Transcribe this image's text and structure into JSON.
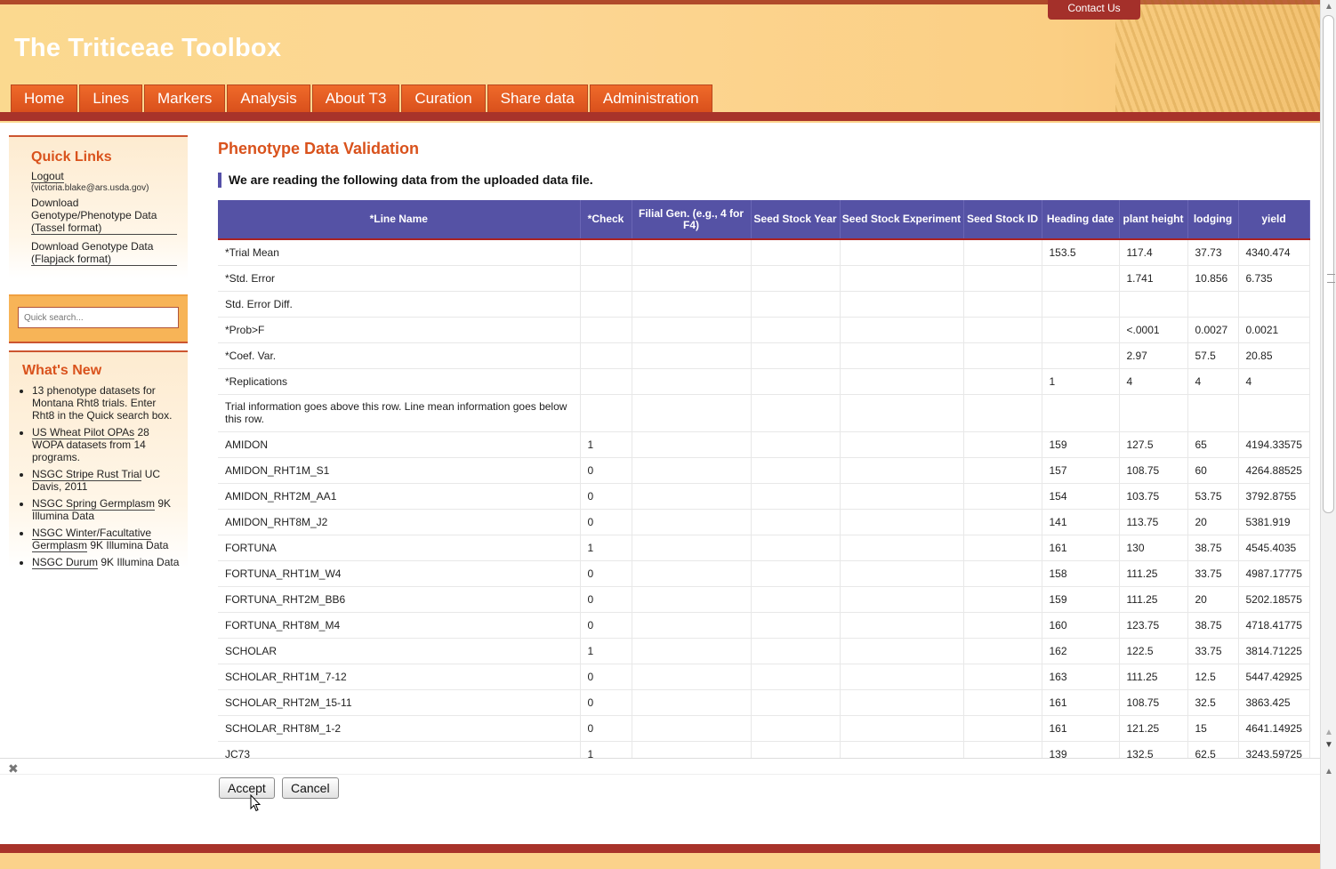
{
  "header": {
    "title": "The Triticeae Toolbox",
    "contact": "Contact Us",
    "nav": [
      "Home",
      "Lines",
      "Markers",
      "Analysis",
      "About T3",
      "Curation",
      "Share data",
      "Administration"
    ]
  },
  "sidebar": {
    "quick_links_title": "Quick Links",
    "logout": "Logout",
    "user_email": "(victoria.blake@ars.usda.gov)",
    "link_tassel": "Download Genotype/Phenotype Data (Tassel format)",
    "link_flapjack": "Download Genotype Data (Flapjack format)",
    "search_placeholder": "Quick search...",
    "whats_new_title": "What's New",
    "news": [
      {
        "link": "",
        "text": "13 phenotype datasets for Montana Rht8 trials. Enter Rht8 in the Quick search box."
      },
      {
        "link": "US Wheat Pilot OPAs",
        "text": " 28 WOPA datasets from 14 programs."
      },
      {
        "link": "NSGC Stripe Rust Trial",
        "text": " UC Davis, 2011"
      },
      {
        "link": "NSGC Spring Germplasm",
        "text": " 9K Illumina Data"
      },
      {
        "link": "NSGC Winter/Facultative Germplasm",
        "text": " 9K Illumina Data"
      },
      {
        "link": "NSGC Durum",
        "text": " 9K Illumina Data"
      }
    ]
  },
  "main": {
    "title": "Phenotype Data Validation",
    "intro": "We are reading the following data from the uploaded data file.",
    "columns": [
      "*Line Name",
      "*Check",
      "Filial Gen. (e.g., 4 for F4)",
      "Seed Stock Year",
      "Seed Stock Experiment",
      "Seed Stock ID",
      "Heading date",
      "plant height",
      "lodging",
      "yield"
    ],
    "rows": [
      [
        "*Trial Mean",
        "",
        "",
        "",
        "",
        "",
        "153.5",
        "117.4",
        "37.73",
        "4340.474"
      ],
      [
        "*Std. Error",
        "",
        "",
        "",
        "",
        "",
        "",
        "1.741",
        "10.856",
        "6.735"
      ],
      [
        "Std. Error Diff.",
        "",
        "",
        "",
        "",
        "",
        "",
        "",
        "",
        ""
      ],
      [
        "*Prob>F",
        "",
        "",
        "",
        "",
        "",
        "",
        "<.0001",
        "0.0027",
        "0.0021"
      ],
      [
        "*Coef. Var.",
        "",
        "",
        "",
        "",
        "",
        "",
        "2.97",
        "57.5",
        "20.85"
      ],
      [
        "*Replications",
        "",
        "",
        "",
        "",
        "",
        "1",
        "4",
        "4",
        "4"
      ],
      [
        "Trial information goes above this row. Line mean information goes below this row.",
        "",
        "",
        "",
        "",
        "",
        "",
        "",
        "",
        ""
      ],
      [
        "AMIDON",
        "1",
        "",
        "",
        "",
        "",
        "159",
        "127.5",
        "65",
        "4194.33575"
      ],
      [
        "AMIDON_RHT1M_S1",
        "0",
        "",
        "",
        "",
        "",
        "157",
        "108.75",
        "60",
        "4264.88525"
      ],
      [
        "AMIDON_RHT2M_AA1",
        "0",
        "",
        "",
        "",
        "",
        "154",
        "103.75",
        "53.75",
        "3792.8755"
      ],
      [
        "AMIDON_RHT8M_J2",
        "0",
        "",
        "",
        "",
        "",
        "141",
        "113.75",
        "20",
        "5381.919"
      ],
      [
        "FORTUNA",
        "1",
        "",
        "",
        "",
        "",
        "161",
        "130",
        "38.75",
        "4545.4035"
      ],
      [
        "FORTUNA_RHT1M_W4",
        "0",
        "",
        "",
        "",
        "",
        "158",
        "111.25",
        "33.75",
        "4987.17775"
      ],
      [
        "FORTUNA_RHT2M_BB6",
        "0",
        "",
        "",
        "",
        "",
        "159",
        "111.25",
        "20",
        "5202.18575"
      ],
      [
        "FORTUNA_RHT8M_M4",
        "0",
        "",
        "",
        "",
        "",
        "160",
        "123.75",
        "38.75",
        "4718.41775"
      ],
      [
        "SCHOLAR",
        "1",
        "",
        "",
        "",
        "",
        "162",
        "122.5",
        "33.75",
        "3814.71225"
      ],
      [
        "SCHOLAR_RHT1M_7-12",
        "0",
        "",
        "",
        "",
        "",
        "163",
        "111.25",
        "12.5",
        "5447.42925"
      ],
      [
        "SCHOLAR_RHT2M_15-11",
        "0",
        "",
        "",
        "",
        "",
        "161",
        "108.75",
        "32.5",
        "3863.425"
      ],
      [
        "SCHOLAR_RHT8M_1-2",
        "0",
        "",
        "",
        "",
        "",
        "161",
        "121.25",
        "15",
        "4641.14925"
      ],
      [
        "JC73",
        "1",
        "",
        "",
        "",
        "",
        "139",
        "132.5",
        "62.5",
        "3243.59725"
      ]
    ],
    "accept_label": "Accept",
    "cancel_label": "Cancel"
  },
  "colors": {
    "accent": "#d9521c",
    "table_header": "#5552a5",
    "bar": "#a8332a"
  }
}
